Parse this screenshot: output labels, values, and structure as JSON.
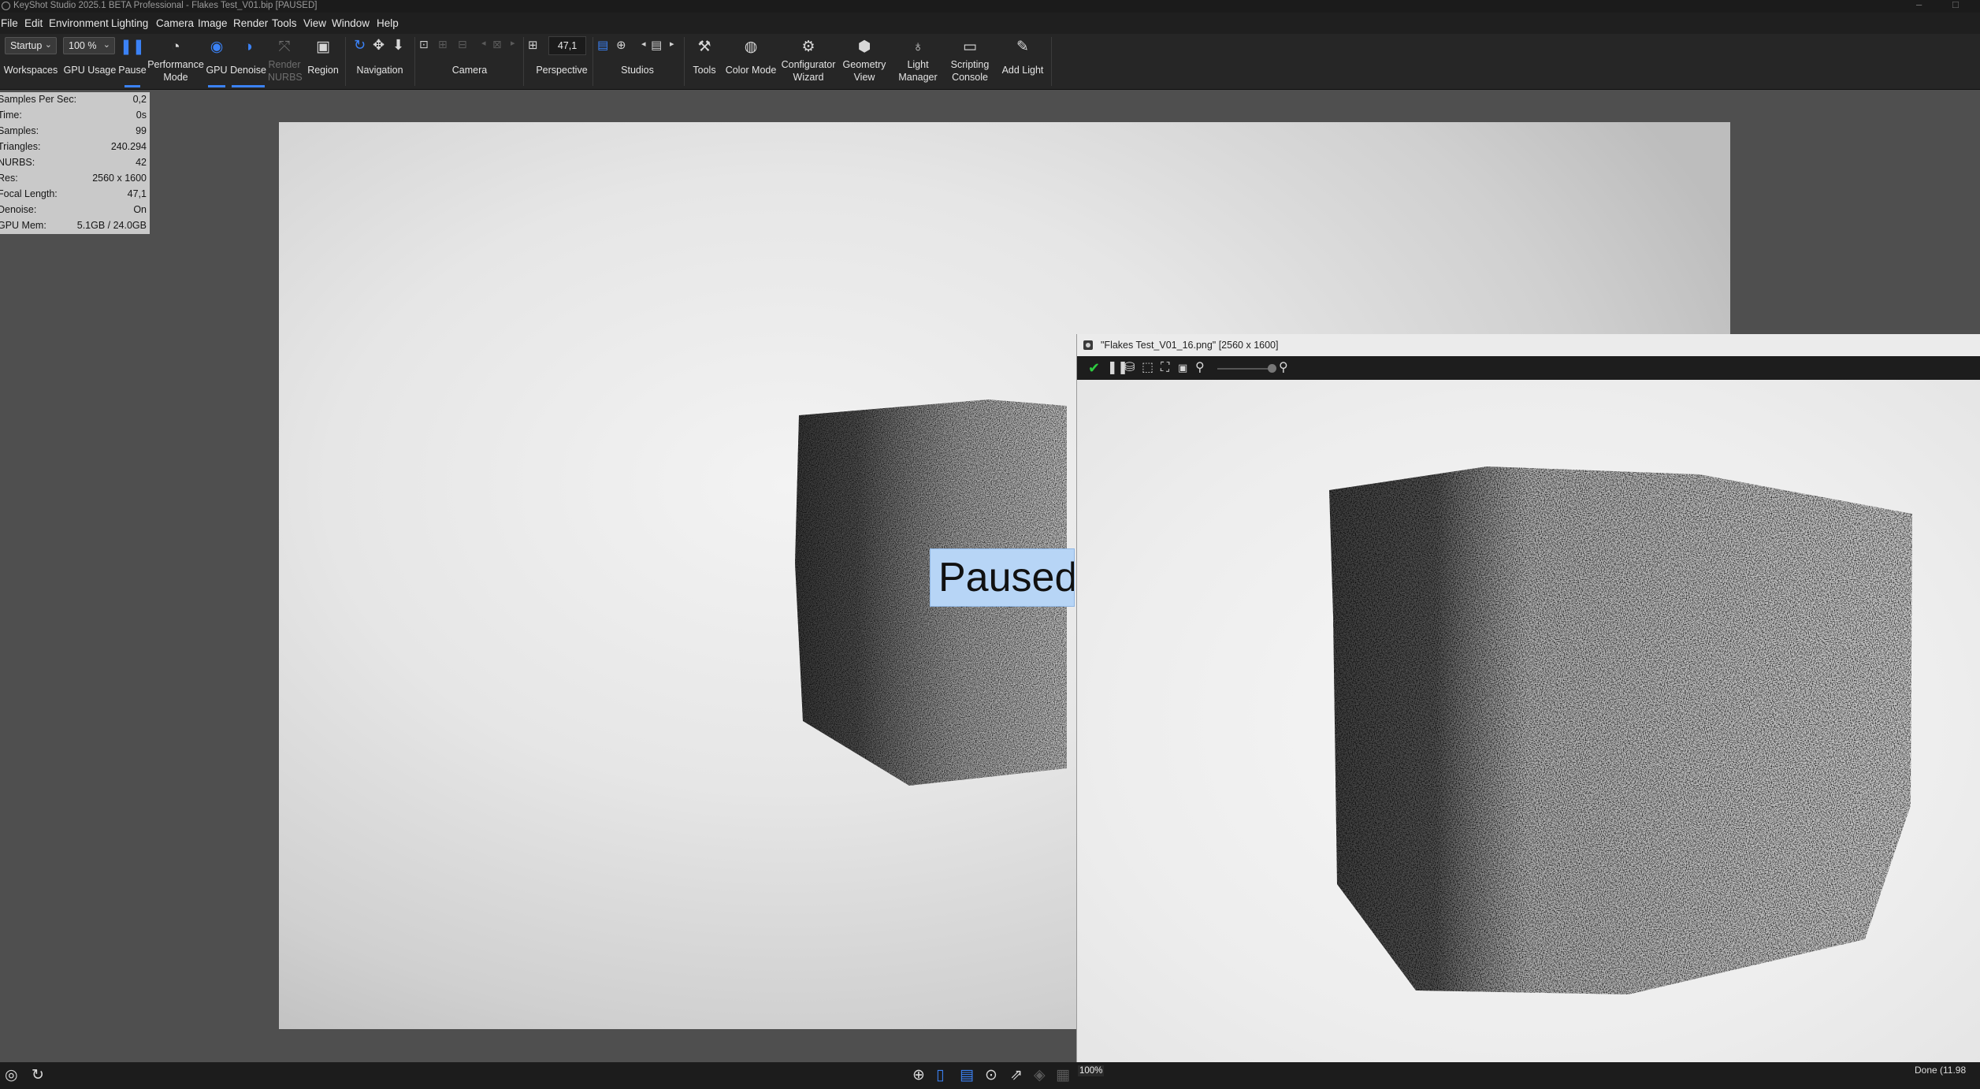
{
  "window": {
    "title": "KeyShot Studio 2025.1 BETA Professional  - Flakes Test_V01.bip  [PAUSED]",
    "controls": [
      "–",
      "□"
    ]
  },
  "menu": [
    "File",
    "Edit",
    "Environment",
    "Lighting",
    "Camera",
    "Image",
    "Render",
    "Tools",
    "View",
    "Window",
    "Help"
  ],
  "ribbon": {
    "workspace_select": "Startup",
    "workspaces_label": "Workspaces",
    "gpu_usage_select": "100 %",
    "gpu_usage_label": "GPU Usage",
    "pause_label": "Pause",
    "performance_mode_label": "Performance\nMode",
    "gpu_label": "GPU",
    "denoise_label": "Denoise",
    "render_nurbs_label": "Render\nNURBS",
    "region_label": "Region",
    "navigation_label": "Navigation",
    "camera_label": "Camera",
    "focal_value": "47,1",
    "perspective_label": "Perspective",
    "studios_label": "Studios",
    "tools_label": "Tools",
    "color_mode_label": "Color Mode",
    "configurator_label": "Configurator\nWizard",
    "geometry_view_label": "Geometry\nView",
    "light_manager_label": "Light\nManager",
    "scripting_console_label": "Scripting\nConsole",
    "add_light_label": "Add Light"
  },
  "stats": [
    {
      "key": "Samples Per Sec:",
      "value": "0,2"
    },
    {
      "key": "Time:",
      "value": "0s"
    },
    {
      "key": "Samples:",
      "value": "99"
    },
    {
      "key": "Triangles:",
      "value": "240.294"
    },
    {
      "key": "NURBS:",
      "value": "42"
    },
    {
      "key": "Res:",
      "value": "2560 x 1600"
    },
    {
      "key": "Focal Length:",
      "value": "47,1"
    },
    {
      "key": "Denoise:",
      "value": "On"
    },
    {
      "key": "GPU Mem:",
      "value": "5.1GB / 24.0GB"
    }
  ],
  "viewport": {
    "paused_text": "Paused"
  },
  "image_window": {
    "title": "\"Flakes Test_V01_16.png\" [2560 x 1600]"
  },
  "statusbar": {
    "zoom": "100%",
    "status": "Done (11.98"
  },
  "colors": {
    "accent": "#3b82f6",
    "paused_badge": "#b7d5f6",
    "stats_bg": "#c9c9c9",
    "viewport_bg": "#e6e6e6"
  }
}
